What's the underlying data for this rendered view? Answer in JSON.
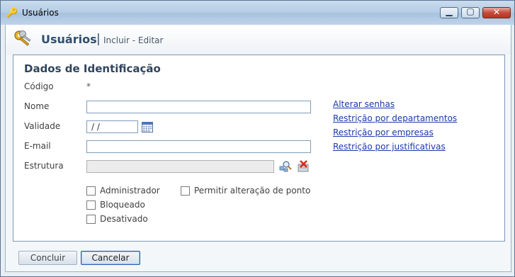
{
  "window": {
    "title": "Usuários"
  },
  "header": {
    "title": "Usuários",
    "separator": "|",
    "subtitle": "Incluir - Editar"
  },
  "section": {
    "title": "Dados de Identificação"
  },
  "form": {
    "codigo_label": "Código",
    "codigo_value": "*",
    "nome_label": "Nome",
    "nome_value": "",
    "validade_label": "Validade",
    "validade_value": " /  /",
    "email_label": "E-mail",
    "email_value": "",
    "estrutura_label": "Estrutura",
    "estrutura_value": ""
  },
  "checkboxes": {
    "administrador": {
      "label": "Administrador",
      "checked": false
    },
    "permitir": {
      "label": "Permitir alteração de ponto",
      "checked": false
    },
    "bloqueado": {
      "label": "Bloqueado",
      "checked": false
    },
    "desativado": {
      "label": "Desativado",
      "checked": false
    }
  },
  "links": [
    "Alterar senhas",
    "Restrição por departamentos",
    "Restrição por empresas",
    "Restrição por justificativas"
  ],
  "buttons": {
    "concluir": "Concluir",
    "cancelar": "Cancelar"
  },
  "icons": {
    "app": "keys-icon",
    "calendar": "calendar-icon",
    "search": "search-structure-icon",
    "clear": "clear-structure-icon"
  }
}
